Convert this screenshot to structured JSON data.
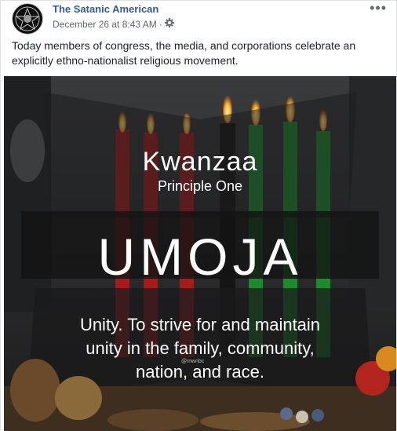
{
  "post": {
    "page_name": "The Satanic American",
    "timestamp": "December 26 at 8:43 AM",
    "separator": "·",
    "more_label": "•••",
    "text": "Today members of congress, the media, and corporations celebrate an explicitly ethno-nationalist religious movement."
  },
  "image": {
    "title": "Kwanzaa",
    "subtitle": "Principle One",
    "headline": "UMOJA",
    "description_lines": [
      "Unity. To strive for and maintain",
      "unity in the family, community,",
      "nation, and race."
    ],
    "watermark": "@mwnbc",
    "candle_colors": [
      "#b01e1e",
      "#b01e1e",
      "#b01e1e",
      "#1d1d1d",
      "#1f8a2e",
      "#1f8a2e",
      "#1f8a2e"
    ]
  },
  "icons": {
    "audience": "gear-icon",
    "avatar": "goat-emblem-icon"
  }
}
